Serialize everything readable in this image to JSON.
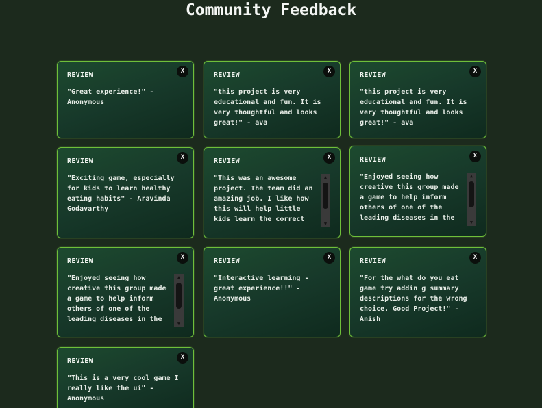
{
  "page": {
    "title": "Community Feedback"
  },
  "icons": {
    "close": "close-icon",
    "scroll_up": "triangle-up-icon",
    "scroll_down": "triangle-down-icon"
  },
  "colors": {
    "background": "#1c2a1d",
    "card_border": "#6fbf3a",
    "card_gradient_start": "#1d4a2f",
    "card_gradient_end": "#0f2a1e",
    "close_button": "#0b0f0c"
  },
  "reviews": [
    {
      "label": "REVIEW",
      "close": "X",
      "text": "\"Great experience!\" - Anonymous"
    },
    {
      "label": "REVIEW",
      "close": "X",
      "text": "\"this project is very educational and fun. It is very thoughtful and looks great!\" - ava"
    },
    {
      "label": "REVIEW",
      "close": "X",
      "text": "\"this project is very educational and fun. It is very thoughtful and looks great!\" - ava"
    },
    {
      "label": "REVIEW",
      "close": "X",
      "text": "\"Exciting game, especially for kids to learn healthy eating habits\" - Aravinda Godavarthy"
    },
    {
      "label": "REVIEW",
      "close": "X",
      "text": "\"This was an awesome project. The team did an amazing job. I like how this will help little kids learn the correct process and nutrition that they need.\""
    },
    {
      "label": "REVIEW",
      "close": "X",
      "text": "\"Enjoyed seeing how creative this group made a game to help inform others of one of the leading diseases in the world. Good job!\" - Anonymous"
    },
    {
      "label": "REVIEW",
      "close": "X",
      "text": "\"Enjoyed seeing how creative this group made a game to help inform others of one of the leading diseases in the world. Good job!\" - Anonymous"
    },
    {
      "label": "REVIEW",
      "close": "X",
      "text": "\"Interactive learning - great experience!!\" - Anonymous"
    },
    {
      "label": "REVIEW",
      "close": "X",
      "text": "\"For the what do you eat game try addin g summary descriptions for the wrong choice. Good Project!\" - Anish"
    },
    {
      "label": "REVIEW",
      "close": "X",
      "text": "\"This is a very cool game I really like the ui\" - Anonymous"
    }
  ]
}
